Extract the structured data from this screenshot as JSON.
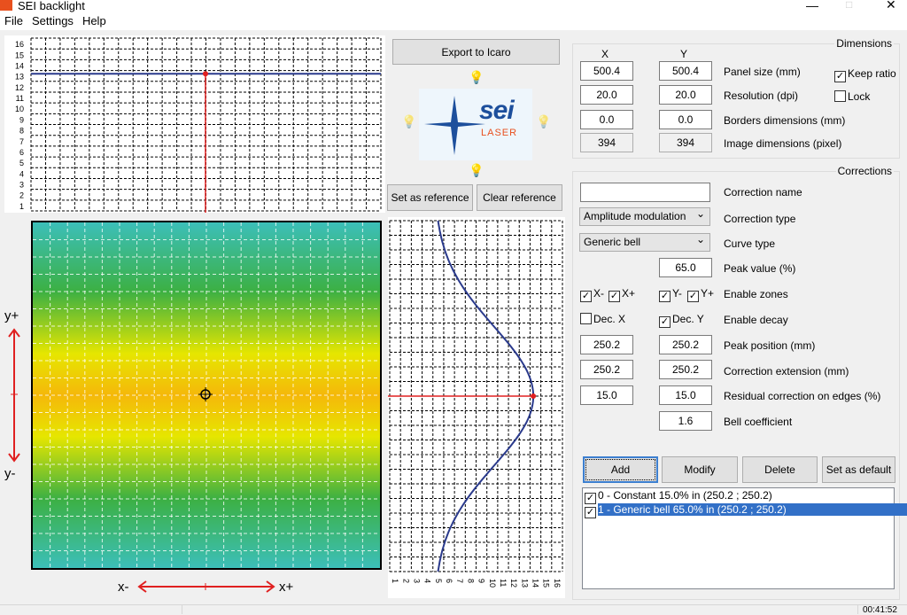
{
  "window": {
    "title": "SEI backlight"
  },
  "menu": [
    "File",
    "Settings",
    "Help"
  ],
  "top_chart": {
    "y_ticks": [
      1,
      2,
      3,
      4,
      5,
      6,
      7,
      8,
      9,
      10,
      11,
      12,
      13,
      14,
      15,
      16
    ],
    "profile_value": 13.2
  },
  "side_chart": {
    "x_ticks": [
      1,
      2,
      3,
      4,
      5,
      6,
      7,
      8,
      9,
      10,
      11,
      12,
      13,
      14,
      15,
      16
    ],
    "peak_value": 13.8,
    "edge_value": 4.6
  },
  "heatmap": {
    "colors": {
      "edge": "#3cbfb9",
      "mid": "#3cb043",
      "yellow": "#e6e600",
      "center": "#f5b80a"
    }
  },
  "axes": {
    "y_plus": "y+",
    "y_minus": "y-",
    "x_minus": "x-",
    "x_plus": "x+"
  },
  "buttons": {
    "export": "Export to Icaro",
    "set_reference": "Set as reference",
    "clear_reference": "Clear reference",
    "add": "Add",
    "modify": "Modify",
    "delete": "Delete",
    "set_default": "Set as default"
  },
  "logo": {
    "brand": "sei",
    "sub": "LASER"
  },
  "dimensions": {
    "title": "Dimensions",
    "col_x": "X",
    "col_y": "Y",
    "rows": [
      {
        "label": "Panel size (mm)",
        "x": "500.4",
        "y": "500.4"
      },
      {
        "label": "Resolution (dpi)",
        "x": "20.0",
        "y": "20.0"
      },
      {
        "label": "Borders dimensions (mm)",
        "x": "0.0",
        "y": "0.0"
      },
      {
        "label": "Image dimensions (pixel)",
        "x": "394",
        "y": "394"
      }
    ],
    "keep_ratio": {
      "label": "Keep ratio",
      "checked": true
    },
    "lock": {
      "label": "Lock",
      "checked": false
    }
  },
  "corrections": {
    "title": "Corrections",
    "name_label": "Correction name",
    "name_value": "",
    "type_label": "Correction type",
    "type_value": "Amplitude modulation",
    "curve_label": "Curve type",
    "curve_value": "Generic bell",
    "peak_label": "Peak value (%)",
    "peak_value": "65.0",
    "zones_label": "Enable zones",
    "zones": {
      "x_minus": "X-",
      "x_plus": "X+",
      "y_minus": "Y-",
      "y_plus": "Y+"
    },
    "decay_label": "Enable decay",
    "dec_x": "Dec. X",
    "dec_y": "Dec. Y",
    "peak_pos_label": "Peak position (mm)",
    "peak_pos_x": "250.2",
    "peak_pos_y": "250.2",
    "ext_label": "Correction extension (mm)",
    "ext_x": "250.2",
    "ext_y": "250.2",
    "resid_label": "Residual correction on edges (%)",
    "resid_x": "15.0",
    "resid_y": "15.0",
    "bell_label": "Bell coefficient",
    "bell_value": "1.6",
    "list": [
      {
        "text": "0 - Constant 15.0% in (250.2 ; 250.2)",
        "checked": true,
        "selected": false
      },
      {
        "text": "1 - Generic bell 65.0% in (250.2 ; 250.2)",
        "checked": true,
        "selected": true
      }
    ]
  },
  "status": {
    "time": "00:41:52"
  }
}
